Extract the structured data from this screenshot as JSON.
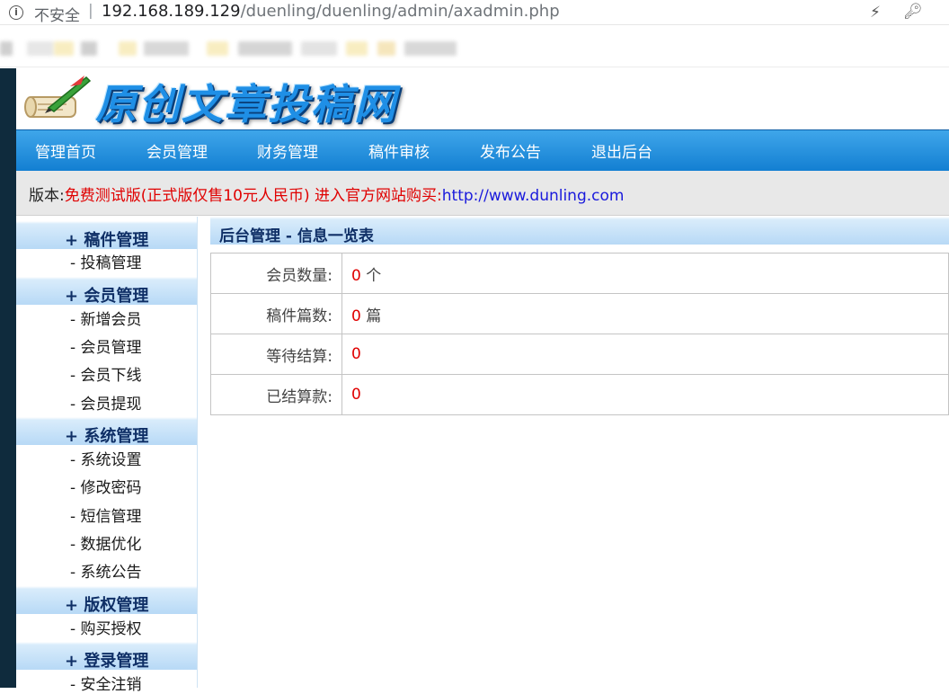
{
  "browser": {
    "insecure_label": "不安全",
    "separator": "|",
    "url_host": "192.168.189.129",
    "url_path": "/duenling/duenling/admin/axadmin.php"
  },
  "icons": {
    "info": "info-circle-icon",
    "bolt": "lightning-icon",
    "key": "key-icon",
    "logo": "quill-scroll-icon"
  },
  "logo": {
    "title": "原创文章投稿网"
  },
  "nav": {
    "items": [
      "管理首页",
      "会员管理",
      "财务管理",
      "稿件审核",
      "发布公告",
      "退出后台"
    ]
  },
  "version": {
    "prefix": "版本:",
    "notice": "免费测试版(正式版仅售10元人民币) 进入官方网站购买:",
    "link": "http://www.dunling.com"
  },
  "sidebar": {
    "groups": [
      {
        "title": "+ 稿件管理",
        "links": [
          "- 投稿管理"
        ]
      },
      {
        "title": "+ 会员管理",
        "links": [
          "- 新增会员",
          "- 会员管理",
          "- 会员下线",
          "- 会员提现"
        ]
      },
      {
        "title": "+ 系统管理",
        "links": [
          "- 系统设置",
          "- 修改密码",
          "- 短信管理",
          "- 数据优化",
          "- 系统公告"
        ]
      },
      {
        "title": "+ 版权管理",
        "links": [
          "- 购买授权"
        ]
      },
      {
        "title": "+ 登录管理",
        "links": [
          "- 安全注销"
        ]
      }
    ]
  },
  "main": {
    "title": "后台管理 - 信息一览表",
    "rows": [
      {
        "label": "会员数量:",
        "value": "0",
        "unit": "个"
      },
      {
        "label": "稿件篇数:",
        "value": "0",
        "unit": "篇"
      },
      {
        "label": "等待结算:",
        "value": "0",
        "unit": ""
      },
      {
        "label": "已结算款:",
        "value": "0",
        "unit": ""
      }
    ]
  },
  "colors": {
    "nav_blue": "#137fd2",
    "alert_red": "#e00000",
    "link_blue": "#1a1adc",
    "side_header": "#b7d9f6",
    "left_stripe": "#0f2b3d"
  }
}
